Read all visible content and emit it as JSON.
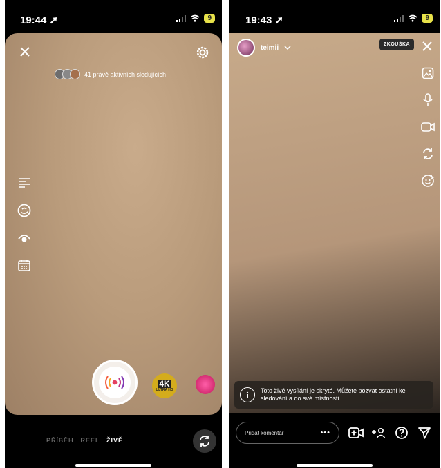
{
  "left": {
    "status": {
      "time": "19:44 ➚",
      "battery": "9"
    },
    "viewers_text": "41 právě aktivních sledujících",
    "tabs": [
      {
        "label": "PŘÍBĚH"
      },
      {
        "label": "REEL"
      },
      {
        "label": "ŽIVĚ"
      }
    ],
    "badge_4k": {
      "big": "4K",
      "small": "ULTRA HD"
    },
    "icons": [
      "close-icon",
      "settings-icon",
      "text-lines-icon",
      "fundraiser-icon",
      "visibility-icon",
      "calendar-icon",
      "live-icon",
      "flip-camera-icon"
    ]
  },
  "right": {
    "status": {
      "time": "19:43 ➚",
      "battery": "9"
    },
    "username": "teimii",
    "rehearsal_label": "ZKOUŠKA",
    "notice_text": "Toto živé vysílání je skryté. Můžete pozvat ostatní ke sledování a do své místnosti.",
    "comment_placeholder": "Přidat komentář",
    "comment_more": "•••",
    "icons": [
      "close-icon",
      "gallery-icon",
      "microphone-icon",
      "camera-icon",
      "flip-icon",
      "effects-icon",
      "info-icon",
      "add-video-icon",
      "add-guest-icon",
      "question-icon",
      "share-icon"
    ]
  },
  "colors": {
    "accent_live": "#e4405f",
    "badge_gold": "#d4ac1c"
  }
}
